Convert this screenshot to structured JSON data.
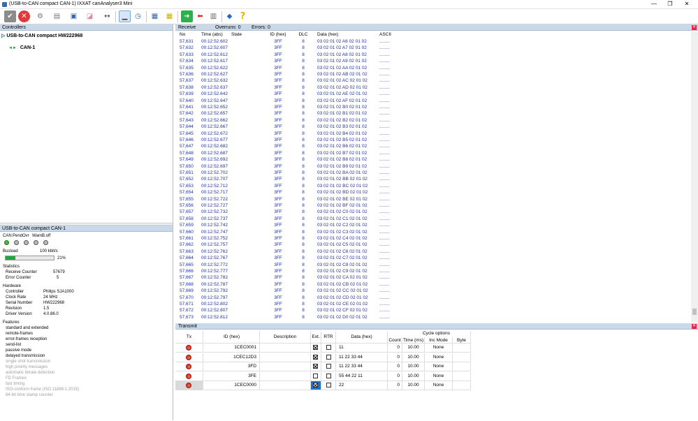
{
  "window": {
    "title": "(USB-to-CAN compact  CAN-1) IXXAT canAnalyser3 Mini",
    "minimize": "—",
    "restore": "❐",
    "close": "✕"
  },
  "toolbar": {
    "icons": [
      "check-icon",
      "stop-icon",
      "settings-icon",
      "filter-icon",
      "save-icon",
      "eraser-icon",
      "width-icon",
      "scroll-icon",
      "clock-icon",
      "network-icon",
      "network2-icon",
      "forward-icon",
      "back-icon",
      "calculator-icon",
      "diamond-icon",
      "help-icon"
    ]
  },
  "controllers": {
    "header": "Controllers",
    "device": "USB-to-CAN compact  HW222968",
    "channel": "CAN-1"
  },
  "status": {
    "header": "USB-to-CAN compact  CAN-1",
    "leds": [
      {
        "label": "CAN",
        "on": true
      },
      {
        "label": "Pend",
        "on": false
      },
      {
        "label": "Ovr",
        "on": false
      },
      {
        "label": "Warn",
        "on": false
      },
      {
        "label": "B.off",
        "on": false
      }
    ],
    "busload_label": "Busload",
    "bitrate": "100 kbit/s",
    "busload_percent": "21%",
    "busload_value": 0.21,
    "statistics_label": "Statistics",
    "receive_counter_label": "Receive Counter",
    "receive_counter": "57679",
    "error_counter_label": "Error Counter",
    "error_counter": "5",
    "hardware_label": "Hardware",
    "hardware": [
      {
        "k": "Controller",
        "v": "Philips SJA1000"
      },
      {
        "k": "Clock Rate",
        "v": "24 MHz"
      },
      {
        "k": "Serial Number",
        "v": "HW222968"
      },
      {
        "k": "Revision",
        "v": "1.5"
      },
      {
        "k": "Driver Version",
        "v": "4.0.86.0"
      }
    ],
    "features_label": "Features",
    "features": [
      {
        "t": "standard   and   extended",
        "on": true
      },
      {
        "t": "remote-frames",
        "on": true
      },
      {
        "t": "error-frames   reception",
        "on": true
      },
      {
        "t": "send-list",
        "on": true
      },
      {
        "t": "passive mode",
        "on": true
      },
      {
        "t": "delayed transmission",
        "on": true
      },
      {
        "t": "single shot transmission",
        "on": false
      },
      {
        "t": "high priority messages",
        "on": false
      },
      {
        "t": "automatic bitrate detection",
        "on": false
      },
      {
        "t": "FD Frames",
        "on": false
      },
      {
        "t": "fast timing",
        "on": false
      },
      {
        "t": "ISO-conform frame (ISO 11898-1:2015)",
        "on": false
      },
      {
        "t": "64-bit time stamp counter",
        "on": false
      }
    ]
  },
  "receive": {
    "title": "Receive",
    "overruns": "Overruns: 0",
    "errors": "Errors: 0",
    "columns": [
      "No",
      "Time (abs)",
      "State",
      "ID (hex)",
      "DLC",
      "Data (hex)",
      "ASCII"
    ],
    "rows": [
      [
        "57,631",
        "00:12:52.602",
        "",
        "3FF",
        "8",
        "03 02 01 02 A6 02 01 02",
        "........"
      ],
      [
        "57,632",
        "00:12:52.607",
        "",
        "3FF",
        "8",
        "03 02 01 02 A7 02 01 02",
        "........"
      ],
      [
        "57,633",
        "00:12:52.612",
        "",
        "3FF",
        "8",
        "03 02 01 02 A8 02 01 02",
        "........"
      ],
      [
        "57,634",
        "00:12:52.617",
        "",
        "3FF",
        "8",
        "03 02 01 02 A9 02 01 02",
        "........"
      ],
      [
        "57,635",
        "00:12:52.622",
        "",
        "3FF",
        "8",
        "03 02 01 02 AA 02 01 02",
        "........"
      ],
      [
        "57,636",
        "00:12:52.627",
        "",
        "3FF",
        "8",
        "03 02 01 02 AB 02 01 02",
        "........"
      ],
      [
        "57,637",
        "00:12:52.632",
        "",
        "3FF",
        "8",
        "03 02 01 02 AC 02 01 02",
        "........"
      ],
      [
        "57,638",
        "00:12:52.637",
        "",
        "3FF",
        "8",
        "03 02 01 02 AD 02 01 02",
        "........"
      ],
      [
        "57,639",
        "00:12:52.642",
        "",
        "3FF",
        "8",
        "03 02 01 02 AE 02 01 02",
        "........"
      ],
      [
        "57,640",
        "00:12:52.647",
        "",
        "3FF",
        "8",
        "03 02 01 02 AF 02 01 02",
        "........"
      ],
      [
        "57,641",
        "00:12:52.652",
        "",
        "3FF",
        "8",
        "03 02 01 02 B0 02 01 02",
        "........"
      ],
      [
        "57,642",
        "00:12:52.657",
        "",
        "3FF",
        "8",
        "03 02 01 02 B1 02 01 02",
        "........"
      ],
      [
        "57,643",
        "00:12:52.662",
        "",
        "3FF",
        "8",
        "03 02 01 02 B2 02 01 02",
        "........"
      ],
      [
        "57,644",
        "00:12:52.667",
        "",
        "3FF",
        "8",
        "03 02 01 02 B3 02 01 02",
        "........"
      ],
      [
        "57,645",
        "00:12:52.672",
        "",
        "3FF",
        "8",
        "03 02 01 02 B4 02 01 02",
        "........"
      ],
      [
        "57,646",
        "00:12:52.677",
        "",
        "3FF",
        "8",
        "03 02 01 02 B5 02 01 02",
        "........"
      ],
      [
        "57,647",
        "00:12:52.682",
        "",
        "3FF",
        "8",
        "03 02 01 02 B6 02 01 02",
        "........"
      ],
      [
        "57,648",
        "00:12:52.687",
        "",
        "3FF",
        "8",
        "03 02 01 02 B7 02 01 02",
        "........"
      ],
      [
        "57,649",
        "00:12:52.692",
        "",
        "3FF",
        "8",
        "03 02 01 02 B8 02 01 02",
        "........"
      ],
      [
        "57,650",
        "00:12:52.697",
        "",
        "3FF",
        "8",
        "03 02 01 02 B9 02 01 02",
        "........"
      ],
      [
        "57,651",
        "00:12:52.702",
        "",
        "3FF",
        "8",
        "03 02 01 02 BA 02 01 02",
        "........"
      ],
      [
        "57,652",
        "00:12:52.707",
        "",
        "3FF",
        "8",
        "03 02 01 02 BB 02 01 02",
        "........"
      ],
      [
        "57,653",
        "00:12:52.712",
        "",
        "3FF",
        "8",
        "03 02 01 02 BC 02 01 02",
        "........"
      ],
      [
        "57,654",
        "00:12:52.717",
        "",
        "3FF",
        "8",
        "03 02 01 02 BD 02 01 02",
        "........"
      ],
      [
        "57,655",
        "00:12:52.722",
        "",
        "3FF",
        "8",
        "03 02 01 02 BE 02 01 02",
        "........"
      ],
      [
        "57,656",
        "00:12:52.727",
        "",
        "3FF",
        "8",
        "03 02 01 02 BF 02 01 02",
        "........"
      ],
      [
        "57,657",
        "00:12:52.732",
        "",
        "3FF",
        "8",
        "03 02 01 02 C0 02 01 02",
        "........"
      ],
      [
        "57,658",
        "00:12:52.737",
        "",
        "3FF",
        "8",
        "03 02 01 02 C1 02 01 02",
        "........"
      ],
      [
        "57,659",
        "00:12:52.742",
        "",
        "3FF",
        "8",
        "03 02 01 02 C2 02 01 02",
        "........"
      ],
      [
        "57,660",
        "00:12:52.747",
        "",
        "3FF",
        "8",
        "03 02 01 02 C3 02 01 02",
        "........"
      ],
      [
        "57,661",
        "00:12:52.752",
        "",
        "3FF",
        "8",
        "03 02 01 02 C4 02 01 02",
        "........"
      ],
      [
        "57,662",
        "00:12:52.757",
        "",
        "3FF",
        "8",
        "03 02 01 02 C5 02 01 02",
        "........"
      ],
      [
        "57,663",
        "00:12:52.762",
        "",
        "3FF",
        "8",
        "03 02 01 02 C6 02 01 02",
        "........"
      ],
      [
        "57,664",
        "00:12:52.767",
        "",
        "3FF",
        "8",
        "03 02 01 02 C7 02 01 02",
        "........"
      ],
      [
        "57,665",
        "00:12:52.772",
        "",
        "3FF",
        "8",
        "03 02 01 02 C8 02 01 02",
        "........"
      ],
      [
        "57,666",
        "00:12:52.777",
        "",
        "3FF",
        "8",
        "03 02 01 02 C9 02 01 02",
        "........"
      ],
      [
        "57,667",
        "00:12:52.782",
        "",
        "3FF",
        "8",
        "03 02 01 02 CA 02 01 02",
        "........"
      ],
      [
        "57,668",
        "00:12:52.787",
        "",
        "3FF",
        "8",
        "03 02 01 02 CB 02 01 02",
        "........"
      ],
      [
        "57,669",
        "00:12:52.792",
        "",
        "3FF",
        "8",
        "03 02 01 02 CC 02 01 02",
        "........"
      ],
      [
        "57,670",
        "00:12:52.797",
        "",
        "3FF",
        "8",
        "03 02 01 02 CD 02 01 02",
        "........"
      ],
      [
        "57,671",
        "00:12:52.802",
        "",
        "3FF",
        "8",
        "03 02 01 02 CE 02 01 02",
        "........"
      ],
      [
        "57,672",
        "00:12:52.807",
        "",
        "3FF",
        "8",
        "03 02 01 02 CF 02 01 02",
        "........"
      ],
      [
        "57,673",
        "00:12:52.812",
        "",
        "3FF",
        "8",
        "03 02 01 02 D0 02 01 02",
        "........"
      ]
    ]
  },
  "transmit": {
    "title": "Transmit",
    "cols": {
      "tx": "Tx",
      "id": "ID (hex)",
      "desc": "Description",
      "ext": "Ext.",
      "rtr": "RTR",
      "data": "Data (hex)",
      "cycle": "Cycle options",
      "count": "Count",
      "time": "Time (ms)",
      "inc": "Inc Mode",
      "byte": "Byte"
    },
    "rows": [
      {
        "id": "1CEC0001",
        "desc": "",
        "ext": true,
        "rtr": false,
        "data": "11",
        "count": "0",
        "time": "10.00",
        "inc": "None",
        "byte": ""
      },
      {
        "id": "1CEC12D3",
        "desc": "",
        "ext": true,
        "rtr": false,
        "data": "11 22 33 44",
        "count": "0",
        "time": "10.00",
        "inc": "None",
        "byte": ""
      },
      {
        "id": "3FD",
        "desc": "",
        "ext": true,
        "rtr": false,
        "data": "11 22 33 44",
        "count": "0",
        "time": "10.00",
        "inc": "None",
        "byte": ""
      },
      {
        "id": "3FE",
        "desc": "",
        "ext": false,
        "rtr": false,
        "data": "55 44 22 11",
        "count": "0",
        "time": "10.00",
        "inc": "None",
        "byte": ""
      },
      {
        "id": "1CEC0000",
        "desc": "",
        "ext": true,
        "rtr": false,
        "data": "22",
        "count": "0",
        "time": "10.00",
        "inc": "None",
        "byte": "",
        "selected": true
      }
    ]
  },
  "colors": {
    "header_bg": "#c9d9ea",
    "rx_text": "#1f2fa0",
    "led_on": "#4ab93d",
    "selected": "#1f73d0"
  }
}
